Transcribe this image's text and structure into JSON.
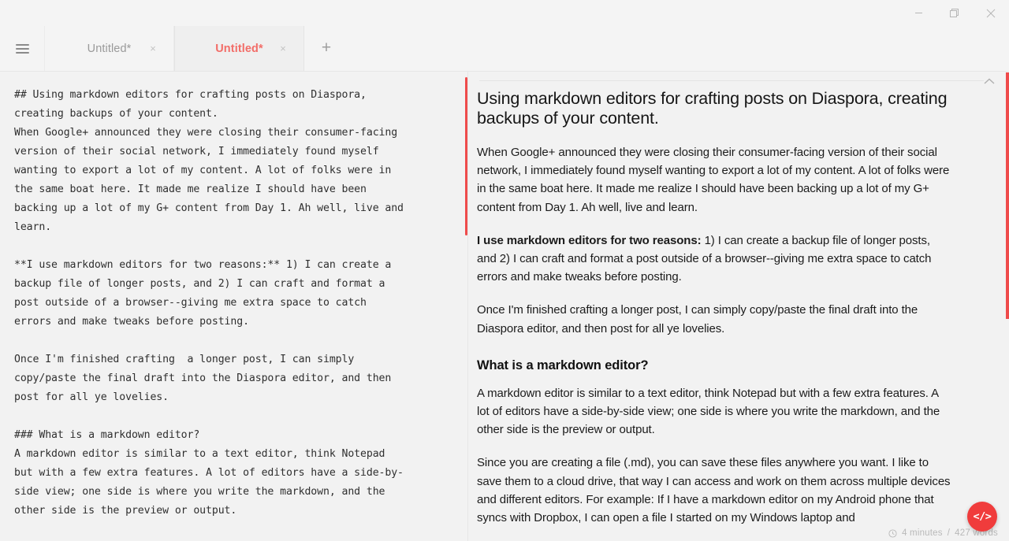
{
  "window": {
    "minimize_label": "minimize",
    "maximize_label": "restore",
    "close_label": "close"
  },
  "tabbar": {
    "menu_label": "menu",
    "new_tab_label": "+",
    "close_glyph": "×",
    "tabs": [
      {
        "title": "Untitled*",
        "active": false
      },
      {
        "title": "Untitled*",
        "active": true
      }
    ]
  },
  "editor": {
    "source": "## Using markdown editors for crafting posts on Diaspora,\ncreating backups of your content.\nWhen Google+ announced they were closing their consumer-facing\nversion of their social network, I immediately found myself\nwanting to export a lot of my content. A lot of folks were in\nthe same boat here. It made me realize I should have been\nbacking up a lot of my G+ content from Day 1. Ah well, live and\nlearn.\n\n**I use markdown editors for two reasons:** 1) I can create a\nbackup file of longer posts, and 2) I can craft and format a\npost outside of a browser--giving me extra space to catch\nerrors and make tweaks before posting.\n\nOnce I'm finished crafting  a longer post, I can simply\ncopy/paste the final draft into the Diaspora editor, and then\npost for all ye lovelies.\n\n### What is a markdown editor?\nA markdown editor is similar to a text editor, think Notepad\nbut with a few extra features. A lot of editors have a side-by-\nside view; one side is where you write the markdown, and the\nother side is the preview or output."
  },
  "preview": {
    "heading1": "Using markdown editors for crafting posts on Diaspora, creating backups of your content.",
    "paragraph1": "When Google+ announced they were closing their consumer-facing version of their social network, I immediately found myself wanting to export a lot of my content. A lot of folks were in the same boat here. It made me realize I should have been backing up a lot of my G+ content from Day 1. Ah well, live and learn.",
    "paragraph2_bold": "I use markdown editors for two reasons:",
    "paragraph2_rest": " 1) I can create a backup file of longer posts, and 2) I can craft and format a post outside of a browser--giving me extra space to catch errors and make tweaks before posting.",
    "paragraph3": "Once I'm finished crafting a longer post, I can simply copy/paste the final draft into the Diaspora editor, and then post for all ye lovelies.",
    "heading2": "What is a markdown editor?",
    "paragraph4": "A markdown editor is similar to a text editor, think Notepad but with a few extra features. A lot of editors have a side-by-side view; one side is where you write the markdown, and the other side is the preview or output.",
    "paragraph5": "Since you are creating a file (.md), you can save these files anywhere you want. I like to save them to a cloud drive, that way I can access and work on them across multiple devices and different editors. For example: If I have a markdown editor on my Android phone that syncs with Dropbox, I can open a file I started on my Windows laptop and"
  },
  "statusbar": {
    "reading_time": "4 minutes",
    "separator": "/",
    "word_count": "427 words"
  },
  "fab": {
    "label": "</>"
  },
  "colors": {
    "accent": "#f26d68",
    "scrollbar": "#ef4b4b",
    "fab_background": "#f03c3c",
    "background": "#f2f2f2",
    "chrome": "#f4f4f4"
  }
}
